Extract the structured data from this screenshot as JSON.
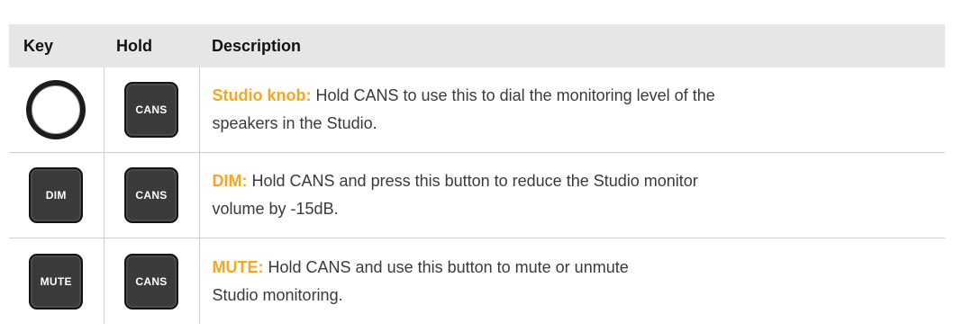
{
  "table": {
    "headers": {
      "key": "Key",
      "hold": "Hold",
      "description": "Description"
    },
    "rows": [
      {
        "key_icon": "knob-icon",
        "hold_label": "CANS",
        "term": "Studio knob:",
        "line1": " Hold CANS to use this to dial the monitoring level of the",
        "line2": "speakers in the Studio."
      },
      {
        "key_label": "DIM",
        "hold_label": "CANS",
        "term": "DIM:",
        "line1": " Hold CANS and press this button to reduce the Studio monitor",
        "line2": "volume by -15dB."
      },
      {
        "key_label": "MUTE",
        "hold_label": "CANS",
        "term": "MUTE:",
        "line1": " Hold CANS and use this button to mute or unmute",
        "line2": "Studio monitoring."
      }
    ]
  },
  "colors": {
    "term_accent": "#f5a623",
    "header_bg": "#e6e6e6",
    "button_bg": "#3a3a3a"
  }
}
